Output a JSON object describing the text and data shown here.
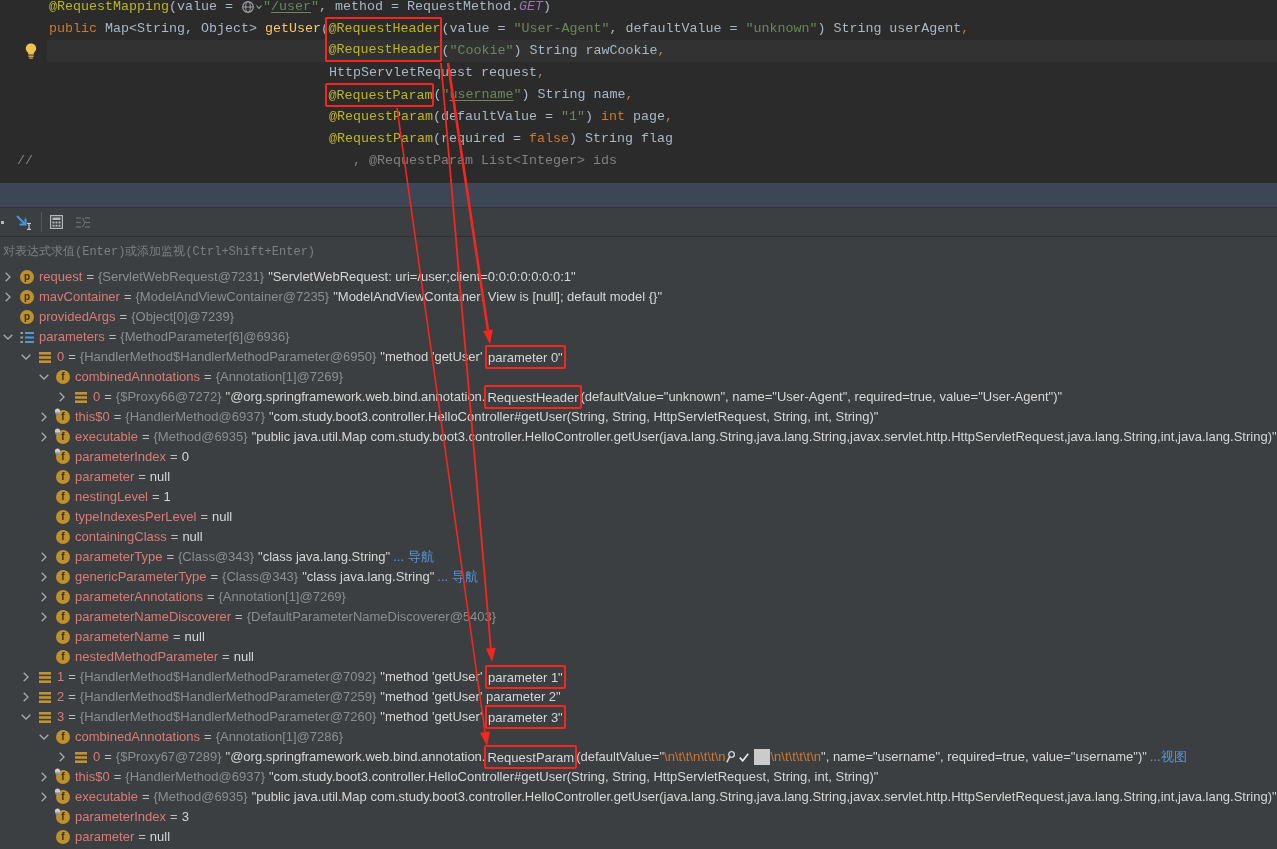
{
  "editor": {
    "lines": [
      {
        "kind": "member",
        "current": false,
        "bulb": false,
        "tokens": [
          {
            "kind": "annotation",
            "text": "@RequestMapping",
            "framed": false
          },
          {
            "kind": "plain",
            "text": "(value = "
          },
          {
            "kind": "inlay"
          },
          {
            "kind": "string",
            "text": "\""
          },
          {
            "kind": "string_ref",
            "text": "/user"
          },
          {
            "kind": "string",
            "text": "\""
          },
          {
            "kind": "plain",
            "text": ", method = RequestMethod."
          },
          {
            "kind": "constant",
            "text": "GET"
          },
          {
            "kind": "plain",
            "text": ")"
          }
        ]
      },
      {
        "kind": "member",
        "current": false,
        "bulb": false,
        "tokens": [
          {
            "kind": "keyword",
            "text": "public"
          },
          {
            "kind": "plain",
            "text": " Map<String, Object> "
          },
          {
            "kind": "method",
            "text": "getUser"
          },
          {
            "kind": "plain",
            "text": "("
          },
          {
            "kind": "annotation",
            "text": "@RequestHeader",
            "framed": true
          },
          {
            "kind": "plain",
            "text": "(value = "
          },
          {
            "kind": "string",
            "text": "\"User-Agent\""
          },
          {
            "kind": "plain",
            "text": ", defaultValue = "
          },
          {
            "kind": "string",
            "text": "\"unknown\""
          },
          {
            "kind": "plain",
            "text": ") String userAgent"
          },
          {
            "kind": "keyword",
            "text": ","
          }
        ]
      },
      {
        "kind": "continuation",
        "current": true,
        "bulb": true,
        "tokens": [
          {
            "kind": "annotation",
            "text": "@RequestHeader",
            "framed": true
          },
          {
            "kind": "plain",
            "text": "("
          },
          {
            "kind": "string",
            "text": "\"Cookie\""
          },
          {
            "kind": "plain",
            "text": ") String rawCookie"
          },
          {
            "kind": "keyword",
            "text": ","
          }
        ]
      },
      {
        "kind": "continuation",
        "current": false,
        "bulb": false,
        "tokens": [
          {
            "kind": "plain",
            "text": "HttpServletRequest request"
          },
          {
            "kind": "keyword",
            "text": ","
          }
        ]
      },
      {
        "kind": "continuation",
        "current": false,
        "bulb": false,
        "tokens": [
          {
            "kind": "annotation",
            "text": "@RequestParam",
            "framed": true
          },
          {
            "kind": "plain",
            "text": "("
          },
          {
            "kind": "string",
            "text": "\""
          },
          {
            "kind": "string_ref",
            "text": "username"
          },
          {
            "kind": "string",
            "text": "\""
          },
          {
            "kind": "plain",
            "text": ") String name"
          },
          {
            "kind": "keyword",
            "text": ","
          }
        ]
      },
      {
        "kind": "continuation",
        "current": false,
        "bulb": false,
        "tokens": [
          {
            "kind": "annotation",
            "text": "@RequestParam",
            "framed": false
          },
          {
            "kind": "plain",
            "text": "(defaultValue = "
          },
          {
            "kind": "string",
            "text": "\"1\""
          },
          {
            "kind": "plain",
            "text": ") "
          },
          {
            "kind": "keyword",
            "text": "int"
          },
          {
            "kind": "plain",
            "text": " page"
          },
          {
            "kind": "keyword",
            "text": ","
          }
        ]
      },
      {
        "kind": "continuation",
        "current": false,
        "bulb": false,
        "tokens": [
          {
            "kind": "annotation",
            "text": "@RequestParam",
            "framed": false
          },
          {
            "kind": "plain",
            "text": "(required = "
          },
          {
            "kind": "keyword",
            "text": "false"
          },
          {
            "kind": "plain",
            "text": ") String flag"
          }
        ]
      },
      {
        "kind": "commented",
        "current": false,
        "bulb": false,
        "marker": "//",
        "tokens": [
          {
            "kind": "comment",
            "text": ", @RequestParam List<Integer> ids"
          }
        ]
      }
    ]
  },
  "debugger": {
    "evaluate_field": {
      "placeholder": "对表达式求值(Enter)或添加监视(Ctrl+Shift+Enter)"
    },
    "variables": [
      {
        "kind": "badge",
        "badge": "p",
        "final": false,
        "expanded": false,
        "name": "request",
        "equals": "=",
        "type": "{ServletWebRequest@7231}",
        "value": [
          {
            "kind": "text",
            "text": "\"ServletWebRequest: uri=/user;client=0:0:0:0:0:0:0:1\"",
            "boxed": false
          }
        ]
      },
      {
        "kind": "badge",
        "badge": "p",
        "final": false,
        "expanded": false,
        "name": "mavContainer",
        "equals": "=",
        "type": "{ModelAndViewContainer@7235}",
        "value": [
          {
            "kind": "text",
            "text": "\"ModelAndViewContainer: View is [null]; default model {}\"",
            "boxed": false
          }
        ]
      },
      {
        "kind": "badge",
        "badge": "p",
        "final": false,
        "name": "providedArgs",
        "equals": "=",
        "type": "{Object[0]@7239}"
      },
      {
        "kind": "array",
        "expanded": true,
        "name": "parameters",
        "equals": "=",
        "type": "{MethodParameter[6]@6936}",
        "children": [
          {
            "kind": "element",
            "expanded": true,
            "name": "0",
            "equals": "=",
            "type": "{HandlerMethod$HandlerMethodParameter@6950}",
            "value": [
              {
                "kind": "text",
                "text": "\"method 'getUser' ",
                "boxed": false
              },
              {
                "kind": "text",
                "text": "parameter 0\"",
                "boxed": true
              }
            ],
            "children": [
              {
                "kind": "badge",
                "badge": "f",
                "final": false,
                "expanded": true,
                "name": "combinedAnnotations",
                "equals": "=",
                "type": "{Annotation[1]@7269}",
                "children": [
                  {
                    "kind": "element",
                    "expanded": false,
                    "name": "0",
                    "equals": "=",
                    "type": "{$Proxy66@7272}",
                    "value": [
                      {
                        "kind": "text",
                        "text": "\"@org.springframework.web.bind.annotation.",
                        "boxed": false
                      },
                      {
                        "kind": "text",
                        "text": "RequestHeader",
                        "boxed": true
                      },
                      {
                        "kind": "text",
                        "text": "(defaultValue=\"unknown\", name=\"User-Agent\", required=true, value=\"User-Agent\")\"",
                        "boxed": false
                      }
                    ]
                  }
                ]
              },
              {
                "kind": "badge",
                "badge": "f",
                "final": true,
                "expanded": false,
                "name": "this$0",
                "equals": "=",
                "type": "{HandlerMethod@6937}",
                "value": [
                  {
                    "kind": "text",
                    "text": "\"com.study.boot3.controller.HelloController#getUser(String, String, HttpServletRequest, String, int, String)\"",
                    "boxed": false
                  }
                ]
              },
              {
                "kind": "badge",
                "badge": "f",
                "final": true,
                "expanded": false,
                "name": "executable",
                "equals": "=",
                "type": "{Method@6935}",
                "value": [
                  {
                    "kind": "text",
                    "text": "\"public java.util.Map com.study.boot3.controller.HelloController.getUser(java.lang.String,java.lang.String,javax.servlet.http.HttpServletRequest,java.lang.String,int,java.lang.String)\"",
                    "boxed": false
                  }
                ]
              },
              {
                "kind": "badge",
                "badge": "f",
                "final": true,
                "name": "parameterIndex",
                "equals": "=",
                "value": [
                  {
                    "kind": "text",
                    "text": "0",
                    "boxed": false
                  }
                ]
              },
              {
                "kind": "badge",
                "badge": "f",
                "final": false,
                "name": "parameter",
                "equals": "=",
                "value": [
                  {
                    "kind": "text",
                    "text": "null",
                    "boxed": false
                  }
                ]
              },
              {
                "kind": "badge",
                "badge": "f",
                "final": false,
                "name": "nestingLevel",
                "equals": "=",
                "value": [
                  {
                    "kind": "text",
                    "text": "1",
                    "boxed": false
                  }
                ]
              },
              {
                "kind": "badge",
                "badge": "f",
                "final": false,
                "name": "typeIndexesPerLevel",
                "equals": "=",
                "value": [
                  {
                    "kind": "text",
                    "text": "null",
                    "boxed": false
                  }
                ]
              },
              {
                "kind": "badge",
                "badge": "f",
                "final": false,
                "name": "containingClass",
                "equals": "=",
                "value": [
                  {
                    "kind": "text",
                    "text": "null",
                    "boxed": false
                  }
                ]
              },
              {
                "kind": "badge",
                "badge": "f",
                "final": false,
                "expanded": false,
                "name": "parameterType",
                "equals": "=",
                "type": "{Class@343}",
                "value": [
                  {
                    "kind": "text",
                    "text": "\"class java.lang.String\"",
                    "boxed": false
                  }
                ],
                "link": "... 导航"
              },
              {
                "kind": "badge",
                "badge": "f",
                "final": false,
                "expanded": false,
                "name": "genericParameterType",
                "equals": "=",
                "type": "{Class@343}",
                "value": [
                  {
                    "kind": "text",
                    "text": "\"class java.lang.String\"",
                    "boxed": false
                  }
                ],
                "link": "... 导航"
              },
              {
                "kind": "badge",
                "badge": "f",
                "final": false,
                "expanded": false,
                "name": "parameterAnnotations",
                "equals": "=",
                "type": "{Annotation[1]@7269}"
              },
              {
                "kind": "badge",
                "badge": "f",
                "final": false,
                "expanded": false,
                "name": "parameterNameDiscoverer",
                "equals": "=",
                "type": "{DefaultParameterNameDiscoverer@5403}"
              },
              {
                "kind": "badge",
                "badge": "f",
                "final": false,
                "name": "parameterName",
                "equals": "=",
                "value": [
                  {
                    "kind": "text",
                    "text": "null",
                    "boxed": false
                  }
                ]
              },
              {
                "kind": "badge",
                "badge": "f",
                "final": false,
                "name": "nestedMethodParameter",
                "equals": "=",
                "value": [
                  {
                    "kind": "text",
                    "text": "null",
                    "boxed": false
                  }
                ]
              }
            ]
          },
          {
            "kind": "element",
            "expanded": false,
            "name": "1",
            "equals": "=",
            "type": "{HandlerMethod$HandlerMethodParameter@7092}",
            "value": [
              {
                "kind": "text",
                "text": "\"method 'getUser' ",
                "boxed": false
              },
              {
                "kind": "text",
                "text": "parameter 1\"",
                "boxed": true
              }
            ]
          },
          {
            "kind": "element",
            "expanded": false,
            "name": "2",
            "equals": "=",
            "type": "{HandlerMethod$HandlerMethodParameter@7259}",
            "value": [
              {
                "kind": "text",
                "text": "\"method 'getUser' parameter 2\"",
                "boxed": false
              }
            ]
          },
          {
            "kind": "element",
            "expanded": true,
            "name": "3",
            "equals": "=",
            "type": "{HandlerMethod$HandlerMethodParameter@7260}",
            "value": [
              {
                "kind": "text",
                "text": "\"method 'getUser' ",
                "boxed": false
              },
              {
                "kind": "text",
                "text": "parameter 3\"",
                "boxed": true
              }
            ],
            "children": [
              {
                "kind": "badge",
                "badge": "f",
                "final": false,
                "expanded": true,
                "name": "combinedAnnotations",
                "equals": "=",
                "type": "{Annotation[1]@7286}",
                "children": [
                  {
                    "kind": "element",
                    "expanded": false,
                    "name": "0",
                    "equals": "=",
                    "type": "{$Proxy67@7289}",
                    "value": [
                      {
                        "kind": "text",
                        "text": "\"@org.springframework.web.bind.annotation.",
                        "boxed": false
                      },
                      {
                        "kind": "text",
                        "text": "RequestParam",
                        "boxed": true
                      },
                      {
                        "kind": "text",
                        "text": "(defaultValue=\"",
                        "boxed": false
                      },
                      {
                        "kind": "escape",
                        "text": "\\n\\t\\t\\n\\t\\t\\n",
                        "boxed": false
                      },
                      {
                        "kind": "search_glyph",
                        "boxed": false
                      },
                      {
                        "kind": "check_glyph",
                        "boxed": false
                      },
                      {
                        "kind": "block_glyph",
                        "boxed": false
                      },
                      {
                        "kind": "escape",
                        "text": "\\n\\t\\t\\t\\t\\n",
                        "boxed": false
                      },
                      {
                        "kind": "text",
                        "text": "\", name=\"username\", required=true, value=\"username\")\"",
                        "boxed": false
                      }
                    ],
                    "link": "...视图"
                  }
                ]
              },
              {
                "kind": "badge",
                "badge": "f",
                "final": true,
                "expanded": false,
                "name": "this$0",
                "equals": "=",
                "type": "{HandlerMethod@6937}",
                "value": [
                  {
                    "kind": "text",
                    "text": "\"com.study.boot3.controller.HelloController#getUser(String, String, HttpServletRequest, String, int, String)\"",
                    "boxed": false
                  }
                ]
              },
              {
                "kind": "badge",
                "badge": "f",
                "final": true,
                "expanded": false,
                "name": "executable",
                "equals": "=",
                "type": "{Method@6935}",
                "value": [
                  {
                    "kind": "text",
                    "text": "\"public java.util.Map com.study.boot3.controller.HelloController.getUser(java.lang.String,java.lang.String,javax.servlet.http.HttpServletRequest,java.lang.String,int,java.lang.String)\"",
                    "boxed": false
                  }
                ]
              },
              {
                "kind": "badge",
                "badge": "f",
                "final": true,
                "name": "parameterIndex",
                "equals": "=",
                "value": [
                  {
                    "kind": "text",
                    "text": "3",
                    "boxed": false
                  }
                ]
              },
              {
                "kind": "badge",
                "badge": "f",
                "final": false,
                "name": "parameter",
                "equals": "=",
                "value": [
                  {
                    "kind": "text",
                    "text": "null",
                    "boxed": false
                  }
                ]
              }
            ]
          }
        ]
      }
    ]
  }
}
